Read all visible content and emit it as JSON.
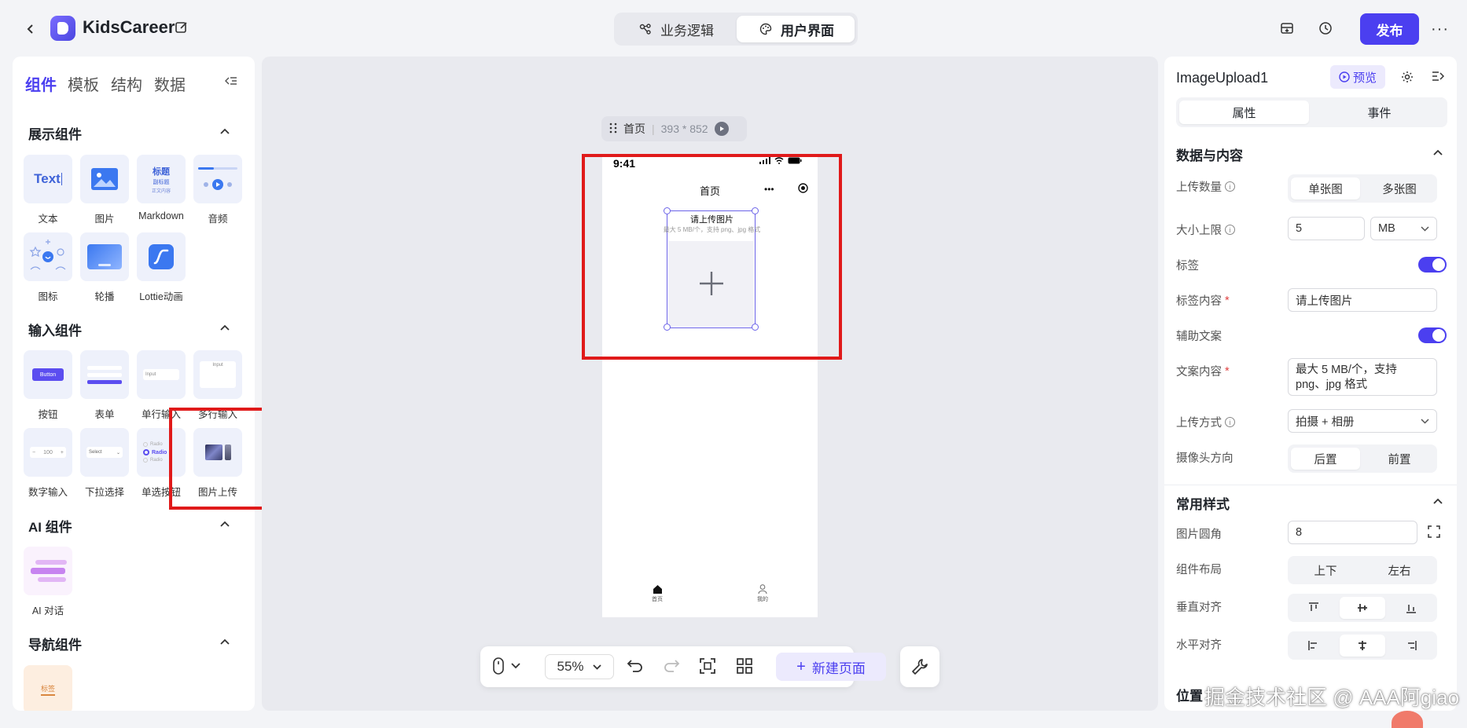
{
  "header": {
    "app_name": "KidsCareer",
    "mode_tabs": [
      "业务逻辑",
      "用户界面"
    ],
    "publish_label": "发布",
    "more_label": "···"
  },
  "left_panel": {
    "tabs": [
      "组件",
      "模板",
      "结构",
      "数据"
    ],
    "sections": {
      "display": {
        "title": "展示组件",
        "items": [
          "文本",
          "图片",
          "Markdown",
          "音频",
          "图标",
          "轮播",
          "Lottie动画"
        ]
      },
      "input": {
        "title": "输入组件",
        "items": [
          "按钮",
          "表单",
          "单行输入",
          "多行输入",
          "数字输入",
          "下拉选择",
          "单选按钮",
          "图片上传"
        ]
      },
      "ai": {
        "title": "AI 组件",
        "items": [
          "AI 对话"
        ]
      },
      "nav": {
        "title": "导航组件",
        "items": [
          "标签"
        ]
      }
    },
    "thumb_text": {
      "text": "Text",
      "md_title": "标题",
      "md_sub": "副标题",
      "md_body": "正文内容",
      "button": "Button",
      "input": "Input",
      "select": "Select",
      "radio": "Radio"
    }
  },
  "canvas": {
    "page_name": "首页",
    "page_size": "393 * 852",
    "phone": {
      "time": "9:41",
      "nav_title": "首页",
      "upload_label": "请上传图片",
      "upload_hint": "最大 5 MB/个，支持 png、jpg 格式",
      "tabbar": [
        "首页",
        "我的"
      ]
    },
    "zoom": "55%",
    "new_page_label": "新建页面"
  },
  "right_panel": {
    "component_name": "ImageUpload1",
    "preview_label": "预览",
    "tabs": [
      "属性",
      "事件"
    ],
    "data_section_title": "数据与内容",
    "style_section_title": "常用样式",
    "next_section_title": "位置",
    "fields": {
      "upload_count": {
        "label": "上传数量",
        "options": [
          "单张图",
          "多张图"
        ],
        "selected": "单张图"
      },
      "size_limit": {
        "label": "大小上限",
        "value": "5",
        "unit": "MB"
      },
      "tag": {
        "label": "标签",
        "on": true
      },
      "tag_content": {
        "label": "标签内容",
        "value": "请上传图片"
      },
      "helper_text": {
        "label": "辅助文案",
        "on": true
      },
      "text_content": {
        "label": "文案内容",
        "value": "最大 5 MB/个，支持 png、jpg 格式"
      },
      "upload_method": {
        "label": "上传方式",
        "value": "拍摄 + 相册"
      },
      "camera_dir": {
        "label": "摄像头方向",
        "options": [
          "后置",
          "前置"
        ],
        "selected": "后置"
      },
      "radius": {
        "label": "图片圆角",
        "value": "8"
      },
      "layout": {
        "label": "组件布局",
        "options": [
          "上下",
          "左右"
        ]
      },
      "v_align": {
        "label": "垂直对齐"
      },
      "h_align": {
        "label": "水平对齐"
      }
    }
  },
  "watermark": "掘金技术社区 @ AAA阿giao",
  "colors": {
    "accent": "#4b3ff0",
    "highlight": "#e01a1a"
  }
}
